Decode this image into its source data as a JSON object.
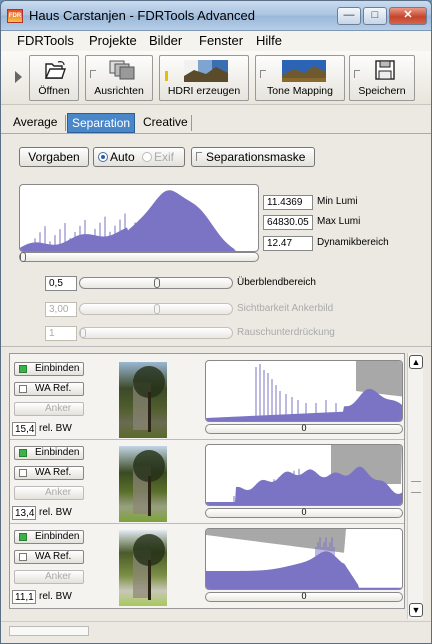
{
  "window": {
    "title": "Haus Carstanjen - FDRTools Advanced",
    "app_icon_text": "FDR"
  },
  "menu": [
    "FDRTools",
    "Projekte",
    "Bilder",
    "Fenster",
    "Hilfe"
  ],
  "toolbar": {
    "open_label": "Öffnen",
    "align_label": "Ausrichten",
    "hdri_label": "HDRI erzeugen",
    "tonemap_label": "Tone Mapping",
    "save_label": "Speichern"
  },
  "tabs": [
    "Average",
    "Separation",
    "Creative"
  ],
  "controls": {
    "presets_label": "Vorgaben",
    "auto_label": "Auto",
    "exif_label": "Exif",
    "mask_label": "Separationsmaske"
  },
  "stats": {
    "min_lumi_value": "11.4369",
    "min_lumi_label": "Min Lumi",
    "max_lumi_value": "64830.05",
    "max_lumi_label": "Max Lumi",
    "range_value": "12.47",
    "range_label": "Dynamikbereich"
  },
  "sliders": {
    "blend_value": "0,5",
    "blend_label": "Überblendbereich",
    "anchor_value": "3,00",
    "anchor_label": "Sichtbarkeit Ankerbild",
    "noise_value": "1",
    "noise_label": "Rauschunterdrückung"
  },
  "images": [
    {
      "include_label": "Einbinden",
      "ref_label": "WA Ref.",
      "anchor_label": "Anker",
      "bw_value": "15,4",
      "bw_label": "rel. BW",
      "slider_value": "0"
    },
    {
      "include_label": "Einbinden",
      "ref_label": "WA Ref.",
      "anchor_label": "Anker",
      "bw_value": "13,4",
      "bw_label": "rel. BW",
      "slider_value": "0"
    },
    {
      "include_label": "Einbinden",
      "ref_label": "WA Ref.",
      "anchor_label": "Anker",
      "bw_value": "11,1",
      "bw_label": "rel. BW",
      "slider_value": "0"
    }
  ],
  "colors": {
    "histogram": "#7b74c4",
    "mask": "#a8a8a8",
    "active_tab": "#4a87c9"
  }
}
